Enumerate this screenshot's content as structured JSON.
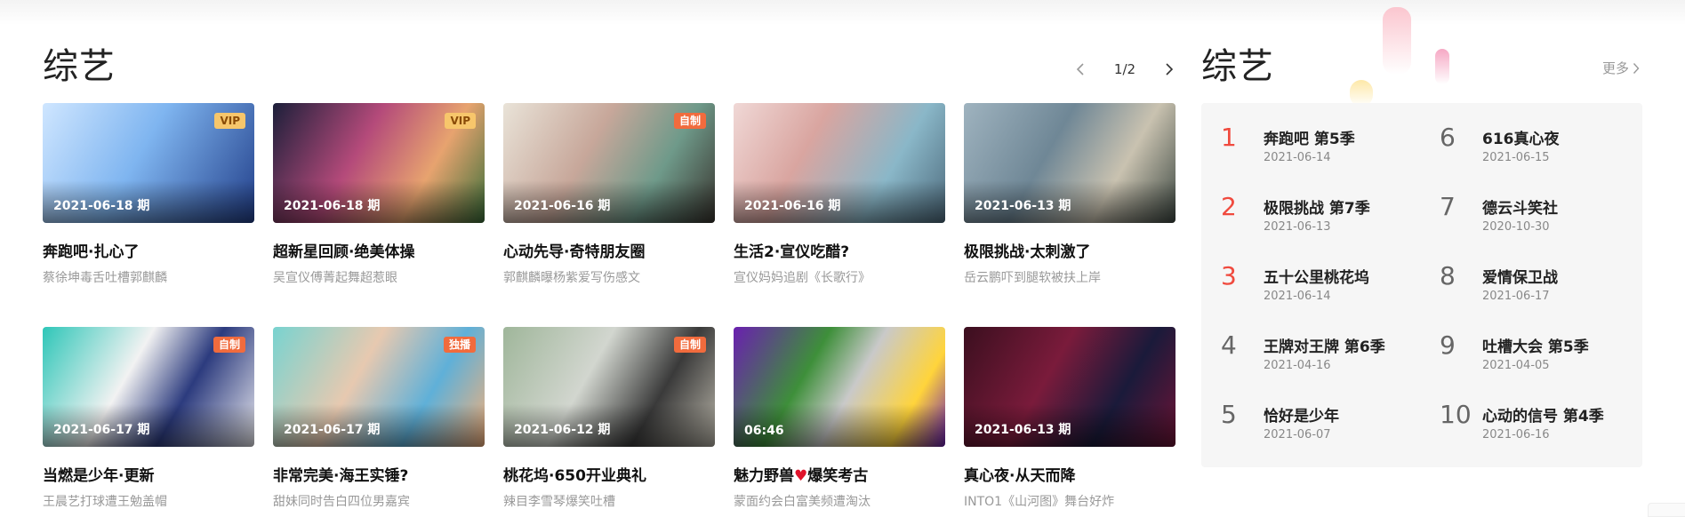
{
  "main": {
    "title": "综艺",
    "pager": "1/2",
    "cards": [
      {
        "date": "2021-06-18 期",
        "badge": "VIP",
        "badge_type": "vip",
        "title": "奔跑吧·扎心了",
        "sub": "蔡徐坤毒舌吐槽郭麒麟",
        "bg": "linear-gradient(120deg,#cfe6ff 0%,#7fb5f0 45%,#223f8a 100%)"
      },
      {
        "date": "2021-06-18 期",
        "badge": "VIP",
        "badge_type": "vip",
        "title": "超新星回顾·绝美体操",
        "sub": "吴宣仪傅菁起舞超惹眼",
        "bg": "linear-gradient(120deg,#1c1f3a 0%,#b44a7a 40%,#e7a36f 70%,#3b6f3a 100%)"
      },
      {
        "date": "2021-06-16 期",
        "badge": "自制",
        "badge_type": "self",
        "title": "心动先导·奇特朋友圈",
        "sub": "郭麒麟曝杨紫爱写伤感文",
        "bg": "linear-gradient(120deg,#e9e3d8 0%,#c7a79a 40%,#6f9a8a 70%,#39352f 100%)"
      },
      {
        "date": "2021-06-16 期",
        "badge": "",
        "badge_type": "",
        "title": "生活2·宣仪吃醋?",
        "sub": "宣仪妈妈追剧《长歌行》",
        "bg": "linear-gradient(120deg,#f0d8d6 0%,#d9a5a0 35%,#8ab7c8 70%,#4e6b7d 100%)"
      },
      {
        "date": "2021-06-13 期",
        "badge": "",
        "badge_type": "",
        "title": "极限挑战·太刺激了",
        "sub": "岳云鹏吓到腿软被扶上岸",
        "bg": "linear-gradient(120deg,#9fb3bf 0%,#6f8796 40%,#c9c2b0 70%,#3f4a44 100%)"
      },
      {
        "date": "2021-06-17 期",
        "badge": "自制",
        "badge_type": "self",
        "title": "当燃是少年·更新",
        "sub": "王晨艺打球遭王勉盖帽",
        "bg": "linear-gradient(120deg,#2ec6b8 0%,#f2f2f2 40%,#2c3b7e 65%,#e8e8ee 100%)"
      },
      {
        "date": "2021-06-17 期",
        "badge": "独播",
        "badge_type": "self",
        "title": "非常完美·海王实锤?",
        "sub": "甜妹同时告白四位男嘉宾",
        "bg": "linear-gradient(120deg,#78d3d0 0%,#e7c9b0 40%,#5fb0d8 70%,#f3b07a 100%)"
      },
      {
        "date": "2021-06-12 期",
        "badge": "自制",
        "badge_type": "self",
        "title": "桃花坞·650开业典礼",
        "sub": "辣目李雪琴爆笑吐槽",
        "bg": "linear-gradient(120deg,#9fb69a 0%,#d2d6cf 40%,#3a3a3a 70%,#b8b4a8 100%)"
      },
      {
        "date": "06:46",
        "badge": "",
        "badge_type": "",
        "title": "魅力野兽",
        "title_after": "爆笑考古",
        "heart": "♥",
        "sub": "蒙面约会白富美频遭淘汰",
        "bg": "linear-gradient(120deg,#6a1fb0 0%,#3e8f3a 35%,#c9c9c9 55%,#ffd43b 80%,#6a1fb0 100%)"
      },
      {
        "date": "2021-06-13 期",
        "badge": "",
        "badge_type": "",
        "title": "真心夜·从天而降",
        "sub": "INTO1《山河图》舞台好炸",
        "bg": "linear-gradient(120deg,#3b0f1f 0%,#7a1b3b 40%,#1a1a3a 70%,#6d1436 100%)"
      }
    ]
  },
  "rank": {
    "title": "综艺",
    "more": "更多",
    "items": [
      {
        "num": "1",
        "name": "奔跑吧 第5季",
        "date": "2021-06-14",
        "hot": true
      },
      {
        "num": "2",
        "name": "极限挑战 第7季",
        "date": "2021-06-13",
        "hot": true
      },
      {
        "num": "3",
        "name": "五十公里桃花坞",
        "date": "2021-06-14",
        "hot": true
      },
      {
        "num": "4",
        "name": "王牌对王牌 第6季",
        "date": "2021-04-16",
        "hot": false
      },
      {
        "num": "5",
        "name": "恰好是少年",
        "date": "2021-06-07",
        "hot": false
      },
      {
        "num": "6",
        "name": "616真心夜",
        "date": "2021-06-15",
        "hot": false
      },
      {
        "num": "7",
        "name": "德云斗笑社",
        "date": "2020-10-30",
        "hot": false
      },
      {
        "num": "8",
        "name": "爱情保卫战",
        "date": "2021-06-17",
        "hot": false
      },
      {
        "num": "9",
        "name": "吐槽大会 第5季",
        "date": "2021-04-05",
        "hot": false
      },
      {
        "num": "10",
        "name": "心动的信号 第4季",
        "date": "2021-06-16",
        "hot": false
      }
    ]
  }
}
